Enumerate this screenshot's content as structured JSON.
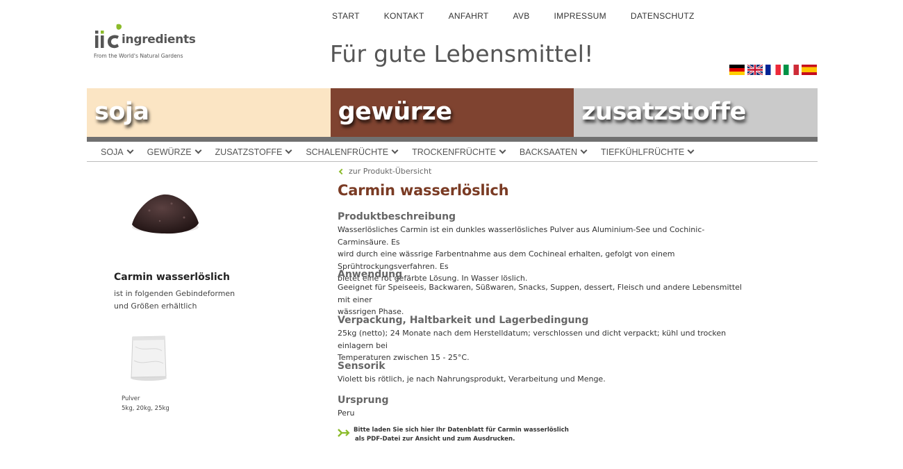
{
  "top_nav": [
    "START",
    "KONTAKT",
    "ANFAHRT",
    "AVB",
    "IMPRESSUM",
    "DATENSCHUTZ"
  ],
  "logo": {
    "brand": "ingredients",
    "tagline": "From the World's Natural Gardens",
    "accent_color": "#8bbb2a"
  },
  "slogan": "Für gute Lebensmittel!",
  "languages": [
    "de",
    "en",
    "fr",
    "it",
    "es"
  ],
  "categories": [
    {
      "label": "soja",
      "color": "#fbe5c4"
    },
    {
      "label": "gewürze",
      "color": "#7f4330"
    },
    {
      "label": "zusatzstoffe",
      "color": "#cacaca"
    }
  ],
  "sub_nav": [
    "SOJA",
    "GEWÜRZE",
    "ZUSATZSTOFFE",
    "SCHALENFRÜCHTE",
    "TROCKENFRÜCHTE",
    "BACKSAATEN",
    "TIEFKÜHLFRÜCHTE"
  ],
  "sidebar": {
    "title": "Carmin wasserlöslich",
    "desc_line1": "ist in folgenden Gebindeformen",
    "desc_line2": "und Größen erhältlich",
    "pack_type": "Pulver",
    "pack_sizes": "5kg, 20kg, 25kg"
  },
  "main": {
    "back_link": "zur Produkt-Übersicht",
    "title": "Carmin wasserlöslich",
    "title_color": "#7a3b24",
    "sections": [
      {
        "heading": "Produktbeschreibung",
        "lines": [
          "Wasserlösliches Carmin ist ein dunkles wasserlösliches Pulver aus Aluminium-See und Cochinic-Carminsäure. Es",
          "wird durch eine wässrige Farbentnahme aus dem Cochineal erhalten, gefolgt von einem Sprühtrockungsverfahren. Es",
          "bietet eine rot gefärbte Lösung. In Wasser löslich."
        ]
      },
      {
        "heading": "Anwendung",
        "lines": [
          "Geeignet für Speiseeis, Backwaren, Süßwaren, Snacks, Suppen, dessert, Fleisch und andere Lebensmittel mit einer",
          "wässrigen Phase."
        ]
      },
      {
        "heading": "Verpackung, Haltbarkeit und Lagerbedingung",
        "lines": [
          "25kg (netto); 24 Monate nach dem Herstelldatum; verschlossen und dicht verpackt; kühl und trocken einlagern bei",
          "Temperaturen zwischen 15 - 25°C."
        ]
      },
      {
        "heading": "Sensorik",
        "lines": [
          "Violett bis rötlich, je nach Nahrungsprodukt, Verarbeitung und Menge."
        ]
      },
      {
        "heading": "Ursprung",
        "lines": [
          "Peru"
        ]
      }
    ],
    "download_line1": "Bitte laden Sie sich hier Ihr Datenblatt für Carmin wasserlöslich",
    "download_line2": "als PDF-Datei zur Ansicht und zum Ausdrucken."
  }
}
